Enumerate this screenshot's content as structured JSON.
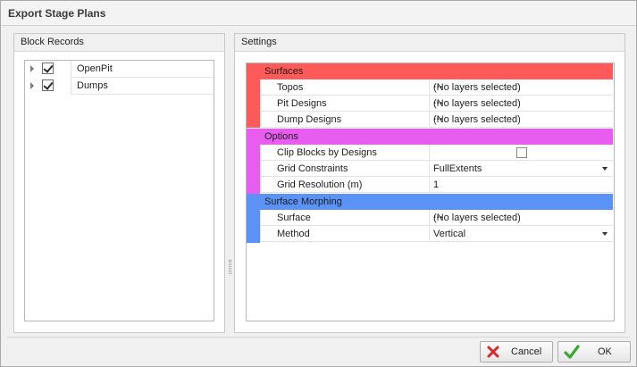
{
  "window": {
    "title": "Export Stage Plans"
  },
  "block_records": {
    "header": "Block Records",
    "items": [
      {
        "label": "OpenPit",
        "checked": true
      },
      {
        "label": "Dumps",
        "checked": true
      }
    ]
  },
  "settings": {
    "header": "Settings",
    "categories": [
      {
        "name": "Surfaces",
        "color": "#ff5a5a",
        "props": [
          {
            "label": "Topos",
            "value": "(No layers selected)",
            "editor": "ellipsis"
          },
          {
            "label": "Pit Designs",
            "value": "(No layers selected)",
            "editor": "ellipsis"
          },
          {
            "label": "Dump Designs",
            "value": "(No layers selected)",
            "editor": "ellipsis"
          }
        ]
      },
      {
        "name": "Options",
        "color": "#e85cf0",
        "props": [
          {
            "label": "Clip Blocks by Designs",
            "value": "",
            "editor": "checkbox"
          },
          {
            "label": "Grid Constraints",
            "value": "FullExtents",
            "editor": "dropdown"
          },
          {
            "label": "Grid Resolution (m)",
            "value": "1",
            "editor": "text"
          }
        ]
      },
      {
        "name": "Surface Morphing",
        "color": "#5a93f5",
        "props": [
          {
            "label": "Surface",
            "value": "(No layers selected)",
            "editor": "ellipsis"
          },
          {
            "label": "Method",
            "value": "Vertical",
            "editor": "dropdown"
          }
        ]
      }
    ],
    "ellipsis_glyph": "···"
  },
  "buttons": {
    "cancel": "Cancel",
    "ok": "OK"
  },
  "icons": {
    "cancel": "red-x-icon",
    "ok": "green-check-icon"
  }
}
